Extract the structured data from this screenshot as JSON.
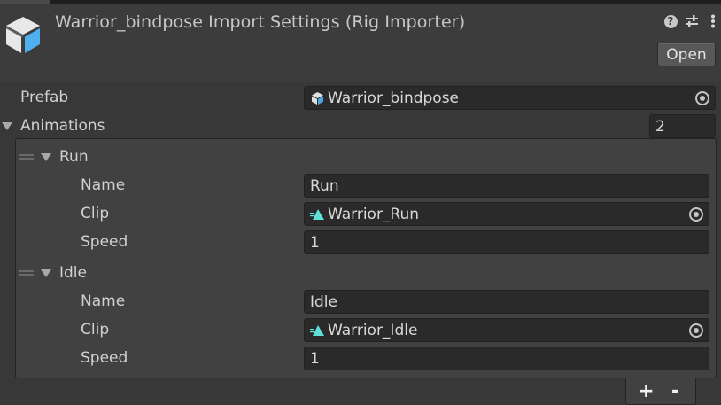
{
  "header": {
    "title": "Warrior_bindpose Import Settings (Rig Importer)",
    "icon": "prefab-cube-icon",
    "open_label": "Open",
    "help_icon": "help-icon",
    "preset_icon": "preset-sliders-icon",
    "menu_icon": "kebab-menu-icon"
  },
  "prefab": {
    "label": "Prefab",
    "value": "Warrior_bindpose",
    "icon": "prefab-icon"
  },
  "animations": {
    "label": "Animations",
    "count": "2",
    "items": [
      {
        "title": "Run",
        "name_label": "Name",
        "name_value": "Run",
        "clip_label": "Clip",
        "clip_value": "Warrior_Run",
        "speed_label": "Speed",
        "speed_value": "1"
      },
      {
        "title": "Idle",
        "name_label": "Name",
        "name_value": "Idle",
        "clip_label": "Clip",
        "clip_value": "Warrior_Idle",
        "speed_label": "Speed",
        "speed_value": "1"
      }
    ],
    "add_label": "+",
    "remove_label": "-"
  },
  "colors": {
    "background": "#383838",
    "field": "#2a2a2a",
    "prefab_icon": "#4aa8e8",
    "clip_icon": "#5ee0d8"
  }
}
